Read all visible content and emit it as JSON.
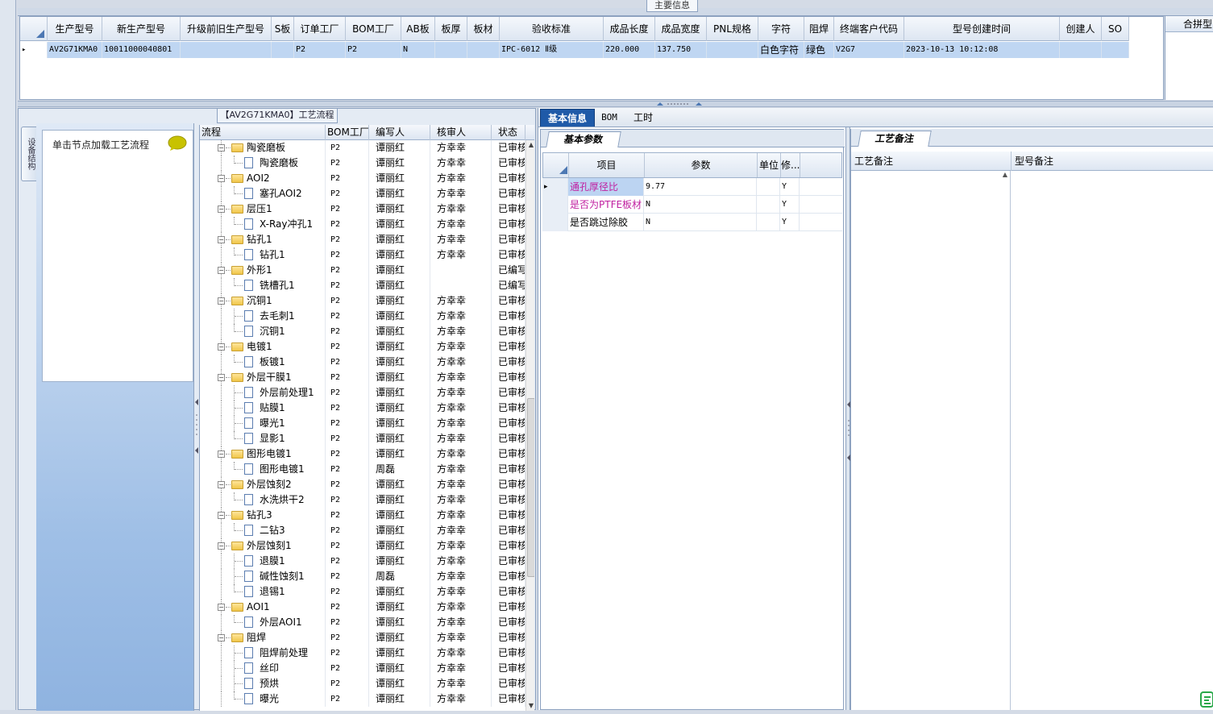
{
  "main_info_label": "主要信息",
  "main_grid": {
    "columns": [
      "生产型号",
      "新生产型号",
      "升级前旧生产型号",
      "S板",
      "订单工厂",
      "BOM工厂",
      "AB板",
      "板厚",
      "板材",
      "验收标准",
      "成品长度",
      "成品宽度",
      "PNL规格",
      "字符",
      "阻焊",
      "终端客户代码",
      "型号创建时间",
      "创建人",
      "SO"
    ],
    "row": [
      "AV2G71KMA0",
      "10011000040801",
      "",
      "",
      "P2",
      "P2",
      "N",
      "",
      "",
      "IPC-6012 Ⅱ级",
      "220.000",
      "137.750",
      "",
      "白色字符",
      "绿色",
      "V2G7",
      "2023-10-13 10:12:08",
      "",
      ""
    ],
    "row_indicator": "▸"
  },
  "merge_panel_header": "合拼型",
  "process_panel": {
    "title": "【AV2G71KMA0】工艺流程",
    "vertical_tab": "设备结构",
    "load_hint": "单击节点加载工艺流程",
    "tree_columns": [
      "流程",
      "BOM工厂",
      "编写人",
      "核审人",
      "状态"
    ],
    "rows": [
      {
        "level": 0,
        "name": "陶瓷磨板",
        "bom": "P2",
        "writer": "谭丽红",
        "reviewer": "方幸幸",
        "status": "已审核"
      },
      {
        "level": 1,
        "name": "陶瓷磨板",
        "bom": "P2",
        "writer": "谭丽红",
        "reviewer": "方幸幸",
        "status": "已审核"
      },
      {
        "level": 0,
        "name": "AOI2",
        "bom": "P2",
        "writer": "谭丽红",
        "reviewer": "方幸幸",
        "status": "已审核"
      },
      {
        "level": 1,
        "name": "塞孔AOI2",
        "bom": "P2",
        "writer": "谭丽红",
        "reviewer": "方幸幸",
        "status": "已审核"
      },
      {
        "level": 0,
        "name": "层压1",
        "bom": "P2",
        "writer": "谭丽红",
        "reviewer": "方幸幸",
        "status": "已审核"
      },
      {
        "level": 1,
        "name": "X-Ray冲孔1",
        "bom": "P2",
        "writer": "谭丽红",
        "reviewer": "方幸幸",
        "status": "已审核"
      },
      {
        "level": 0,
        "name": "钻孔1",
        "bom": "P2",
        "writer": "谭丽红",
        "reviewer": "方幸幸",
        "status": "已审核"
      },
      {
        "level": 1,
        "name": "钻孔1",
        "bom": "P2",
        "writer": "谭丽红",
        "reviewer": "方幸幸",
        "status": "已审核"
      },
      {
        "level": 0,
        "name": "外形1",
        "bom": "P2",
        "writer": "谭丽红",
        "reviewer": "",
        "status": "已编写"
      },
      {
        "level": 1,
        "name": "铣槽孔1",
        "bom": "P2",
        "writer": "谭丽红",
        "reviewer": "",
        "status": "已编写"
      },
      {
        "level": 0,
        "name": "沉铜1",
        "bom": "P2",
        "writer": "谭丽红",
        "reviewer": "方幸幸",
        "status": "已审核"
      },
      {
        "level": 1,
        "name": "去毛刺1",
        "bom": "P2",
        "writer": "谭丽红",
        "reviewer": "方幸幸",
        "status": "已审核"
      },
      {
        "level": 1,
        "name": "沉铜1",
        "bom": "P2",
        "writer": "谭丽红",
        "reviewer": "方幸幸",
        "status": "已审核"
      },
      {
        "level": 0,
        "name": "电镀1",
        "bom": "P2",
        "writer": "谭丽红",
        "reviewer": "方幸幸",
        "status": "已审核"
      },
      {
        "level": 1,
        "name": "板镀1",
        "bom": "P2",
        "writer": "谭丽红",
        "reviewer": "方幸幸",
        "status": "已审核"
      },
      {
        "level": 0,
        "name": "外层干膜1",
        "bom": "P2",
        "writer": "谭丽红",
        "reviewer": "方幸幸",
        "status": "已审核"
      },
      {
        "level": 1,
        "name": "外层前处理1",
        "bom": "P2",
        "writer": "谭丽红",
        "reviewer": "方幸幸",
        "status": "已审核"
      },
      {
        "level": 1,
        "name": "贴膜1",
        "bom": "P2",
        "writer": "谭丽红",
        "reviewer": "方幸幸",
        "status": "已审核"
      },
      {
        "level": 1,
        "name": "曝光1",
        "bom": "P2",
        "writer": "谭丽红",
        "reviewer": "方幸幸",
        "status": "已审核"
      },
      {
        "level": 1,
        "name": "显影1",
        "bom": "P2",
        "writer": "谭丽红",
        "reviewer": "方幸幸",
        "status": "已审核"
      },
      {
        "level": 0,
        "name": "图形电镀1",
        "bom": "P2",
        "writer": "谭丽红",
        "reviewer": "方幸幸",
        "status": "已审核"
      },
      {
        "level": 1,
        "name": "图形电镀1",
        "bom": "P2",
        "writer": "周磊",
        "reviewer": "方幸幸",
        "status": "已审核"
      },
      {
        "level": 0,
        "name": "外层蚀刻2",
        "bom": "P2",
        "writer": "谭丽红",
        "reviewer": "方幸幸",
        "status": "已审核"
      },
      {
        "level": 1,
        "name": "水洗烘干2",
        "bom": "P2",
        "writer": "谭丽红",
        "reviewer": "方幸幸",
        "status": "已审核"
      },
      {
        "level": 0,
        "name": "钻孔3",
        "bom": "P2",
        "writer": "谭丽红",
        "reviewer": "方幸幸",
        "status": "已审核"
      },
      {
        "level": 1,
        "name": "二钻3",
        "bom": "P2",
        "writer": "谭丽红",
        "reviewer": "方幸幸",
        "status": "已审核"
      },
      {
        "level": 0,
        "name": "外层蚀刻1",
        "bom": "P2",
        "writer": "谭丽红",
        "reviewer": "方幸幸",
        "status": "已审核"
      },
      {
        "level": 1,
        "name": "退膜1",
        "bom": "P2",
        "writer": "谭丽红",
        "reviewer": "方幸幸",
        "status": "已审核"
      },
      {
        "level": 1,
        "name": "碱性蚀刻1",
        "bom": "P2",
        "writer": "周磊",
        "reviewer": "方幸幸",
        "status": "已审核"
      },
      {
        "level": 1,
        "name": "退锡1",
        "bom": "P2",
        "writer": "谭丽红",
        "reviewer": "方幸幸",
        "status": "已审核"
      },
      {
        "level": 0,
        "name": "AOI1",
        "bom": "P2",
        "writer": "谭丽红",
        "reviewer": "方幸幸",
        "status": "已审核"
      },
      {
        "level": 1,
        "name": "外层AOI1",
        "bom": "P2",
        "writer": "谭丽红",
        "reviewer": "方幸幸",
        "status": "已审核"
      },
      {
        "level": 0,
        "name": "阻焊",
        "bom": "P2",
        "writer": "谭丽红",
        "reviewer": "方幸幸",
        "status": "已审核"
      },
      {
        "level": 1,
        "name": "阻焊前处理",
        "bom": "P2",
        "writer": "谭丽红",
        "reviewer": "方幸幸",
        "status": "已审核"
      },
      {
        "level": 1,
        "name": "丝印",
        "bom": "P2",
        "writer": "谭丽红",
        "reviewer": "方幸幸",
        "status": "已审核"
      },
      {
        "level": 1,
        "name": "预烘",
        "bom": "P2",
        "writer": "谭丽红",
        "reviewer": "方幸幸",
        "status": "已审核"
      },
      {
        "level": 1,
        "name": "曝光",
        "bom": "P2",
        "writer": "谭丽红",
        "reviewer": "方幸幸",
        "status": "已审核"
      }
    ]
  },
  "tabs": [
    "基本信息",
    "BOM",
    "工时"
  ],
  "basic_params": {
    "tab_label": "基本参数",
    "columns": [
      "项目",
      "参数",
      "单位",
      "修..."
    ],
    "rows": [
      {
        "item": "通孔厚径比",
        "param": "9.77",
        "unit": "",
        "modify": "Y"
      },
      {
        "item": "是否为PTFE板材",
        "param": "N",
        "unit": "",
        "modify": "Y"
      },
      {
        "item": "是否跳过除胶",
        "param": "N",
        "unit": "",
        "modify": "Y"
      }
    ],
    "item_color": "#c01fa0",
    "selected_item_bg": "#bcd4f2"
  },
  "notes": {
    "tab_label": "工艺备注",
    "columns": [
      "工艺备注",
      "型号备注"
    ]
  },
  "colors": {
    "active_tab": "#1f5aa8",
    "grid_selected_row": "#bfd6f2",
    "nav_gradient_bottom": "#8fb3e0"
  },
  "icons": {
    "chat": "chat-bubble-icon",
    "folder": "folder-icon",
    "document": "document-icon"
  }
}
